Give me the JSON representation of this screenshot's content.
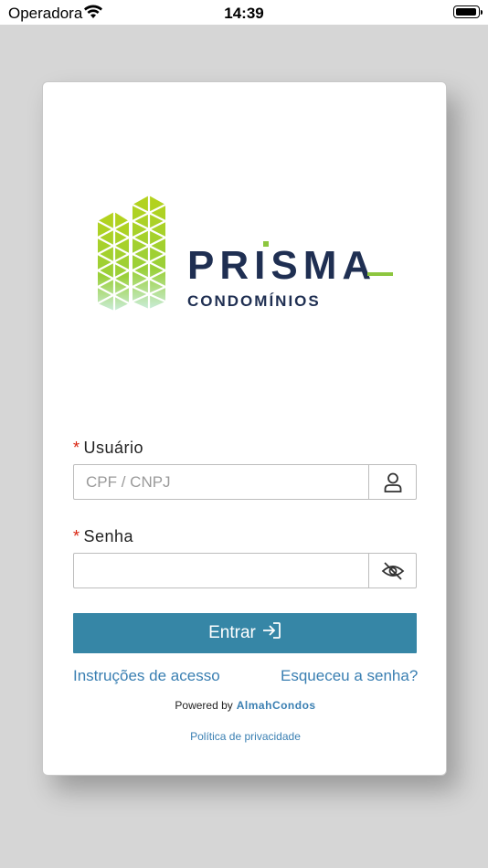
{
  "status_bar": {
    "carrier": "Operadora",
    "time": "14:39"
  },
  "logo": {
    "brand": "PRISMA",
    "subtitle": "CONDOMÍNIOS",
    "accent_color": "#8dc63f",
    "brand_color": "#1f2f52"
  },
  "form": {
    "user": {
      "required_mark": "*",
      "label": "Usuário",
      "placeholder": "CPF / CNPJ",
      "value": "",
      "icon": "user-icon"
    },
    "password": {
      "required_mark": "*",
      "label": "Senha",
      "placeholder": "",
      "value": "",
      "icon": "eye-slash-icon"
    },
    "submit_label": "Entrar",
    "submit_icon": "login-arrow-icon",
    "submit_color": "#3686a6"
  },
  "links": {
    "instructions": "Instruções de acesso",
    "forgot": "Esqueceu a senha?",
    "powered_by": "Powered by",
    "powered_brand": "AlmahCondos",
    "privacy": "Política de privacidade"
  }
}
